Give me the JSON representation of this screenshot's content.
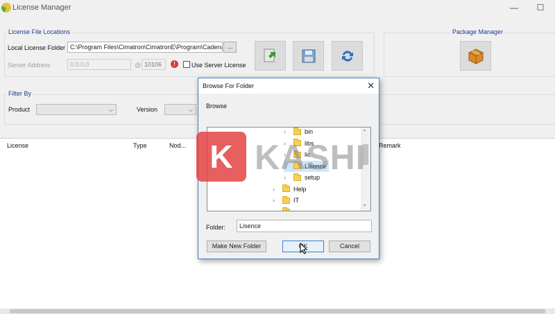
{
  "window": {
    "title": "License Manager",
    "minimize": "—",
    "maximize": "☐"
  },
  "license_file_locations": {
    "title": "License File Locations",
    "local_label": "Local License Folder",
    "local_value": "C:\\Program Files\\Cimatron\\CimatronE\\Program\\Cadena",
    "browse_label": "...",
    "server_label": "Server Address",
    "server_value": "0.0.0.0",
    "port_prefix": "@",
    "port_value": "10106",
    "use_server_label": "Use Server License"
  },
  "package_manager": {
    "title": "Package Manager"
  },
  "filter_by": {
    "title": "Filter By",
    "product_label": "Product",
    "version_label": "Version"
  },
  "table": {
    "columns": [
      "License",
      "Type",
      "Nod...",
      "Remark"
    ]
  },
  "dialog": {
    "title": "Browse For Folder",
    "close": "✕",
    "prompt": "Browse",
    "tree": [
      {
        "label": "bin",
        "expandable": true,
        "selected": false
      },
      {
        "label": "libs",
        "expandable": true,
        "selected": false
      },
      {
        "label": "lic",
        "expandable": true,
        "selected": false
      },
      {
        "label": "Lisence",
        "expandable": false,
        "selected": true
      },
      {
        "label": "setup",
        "expandable": true,
        "selected": false
      },
      {
        "label": "Help",
        "expandable": true,
        "selected": false
      },
      {
        "label": "IT",
        "expandable": true,
        "selected": false
      },
      {
        "label": "...",
        "expandable": true,
        "selected": false
      }
    ],
    "folder_label": "Folder:",
    "folder_value": "Lisence",
    "new_folder_button": "Make New Folder",
    "ok_button": "OK",
    "cancel_button": "Cancel"
  },
  "watermark": {
    "letter": "K",
    "text": "KASHI"
  },
  "colors": {
    "group_title": "#1a3d8f",
    "selection": "#cce8ff",
    "dialog_border": "#3c7fc8"
  }
}
